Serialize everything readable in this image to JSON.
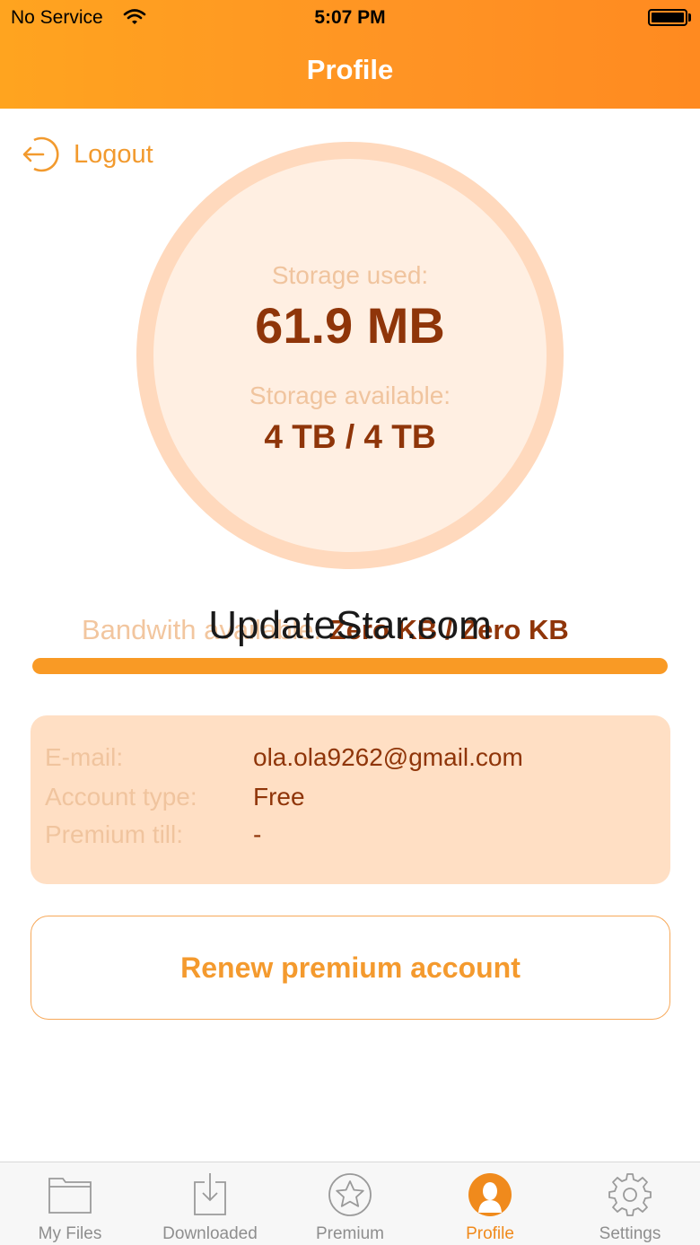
{
  "status_bar": {
    "carrier": "No Service",
    "time": "5:07 PM"
  },
  "header": {
    "title": "Profile"
  },
  "logout": {
    "label": "Logout"
  },
  "storage": {
    "used_label": "Storage used:",
    "used_value": "61.9 MB",
    "available_label": "Storage available:",
    "available_value": "4 TB / 4 TB"
  },
  "bandwidth": {
    "label": "Bandwith available:",
    "value": "Zero KB / Zero KB",
    "fill_fraction": 1.0
  },
  "watermark": "UpdateStar.com",
  "account_info": {
    "rows": [
      {
        "label": "E-mail:",
        "value": "ola.ola9262@gmail.com"
      },
      {
        "label": "Account type:",
        "value": "Free"
      },
      {
        "label": "Premium till:",
        "value": "-"
      }
    ]
  },
  "renew_button": {
    "label": "Renew premium account"
  },
  "tabs": [
    {
      "label": "My Files",
      "icon": "folder-icon",
      "active": false
    },
    {
      "label": "Downloaded",
      "icon": "download-icon",
      "active": false
    },
    {
      "label": "Premium",
      "icon": "star-icon",
      "active": false
    },
    {
      "label": "Profile",
      "icon": "profile-icon",
      "active": true
    },
    {
      "label": "Settings",
      "icon": "gear-icon",
      "active": false
    }
  ],
  "colors": {
    "accent": "#f99a25",
    "header": "#ff9a22",
    "dark_text": "#8f3509",
    "light_text": "#f0c49e",
    "card": "#ffdfc4"
  }
}
